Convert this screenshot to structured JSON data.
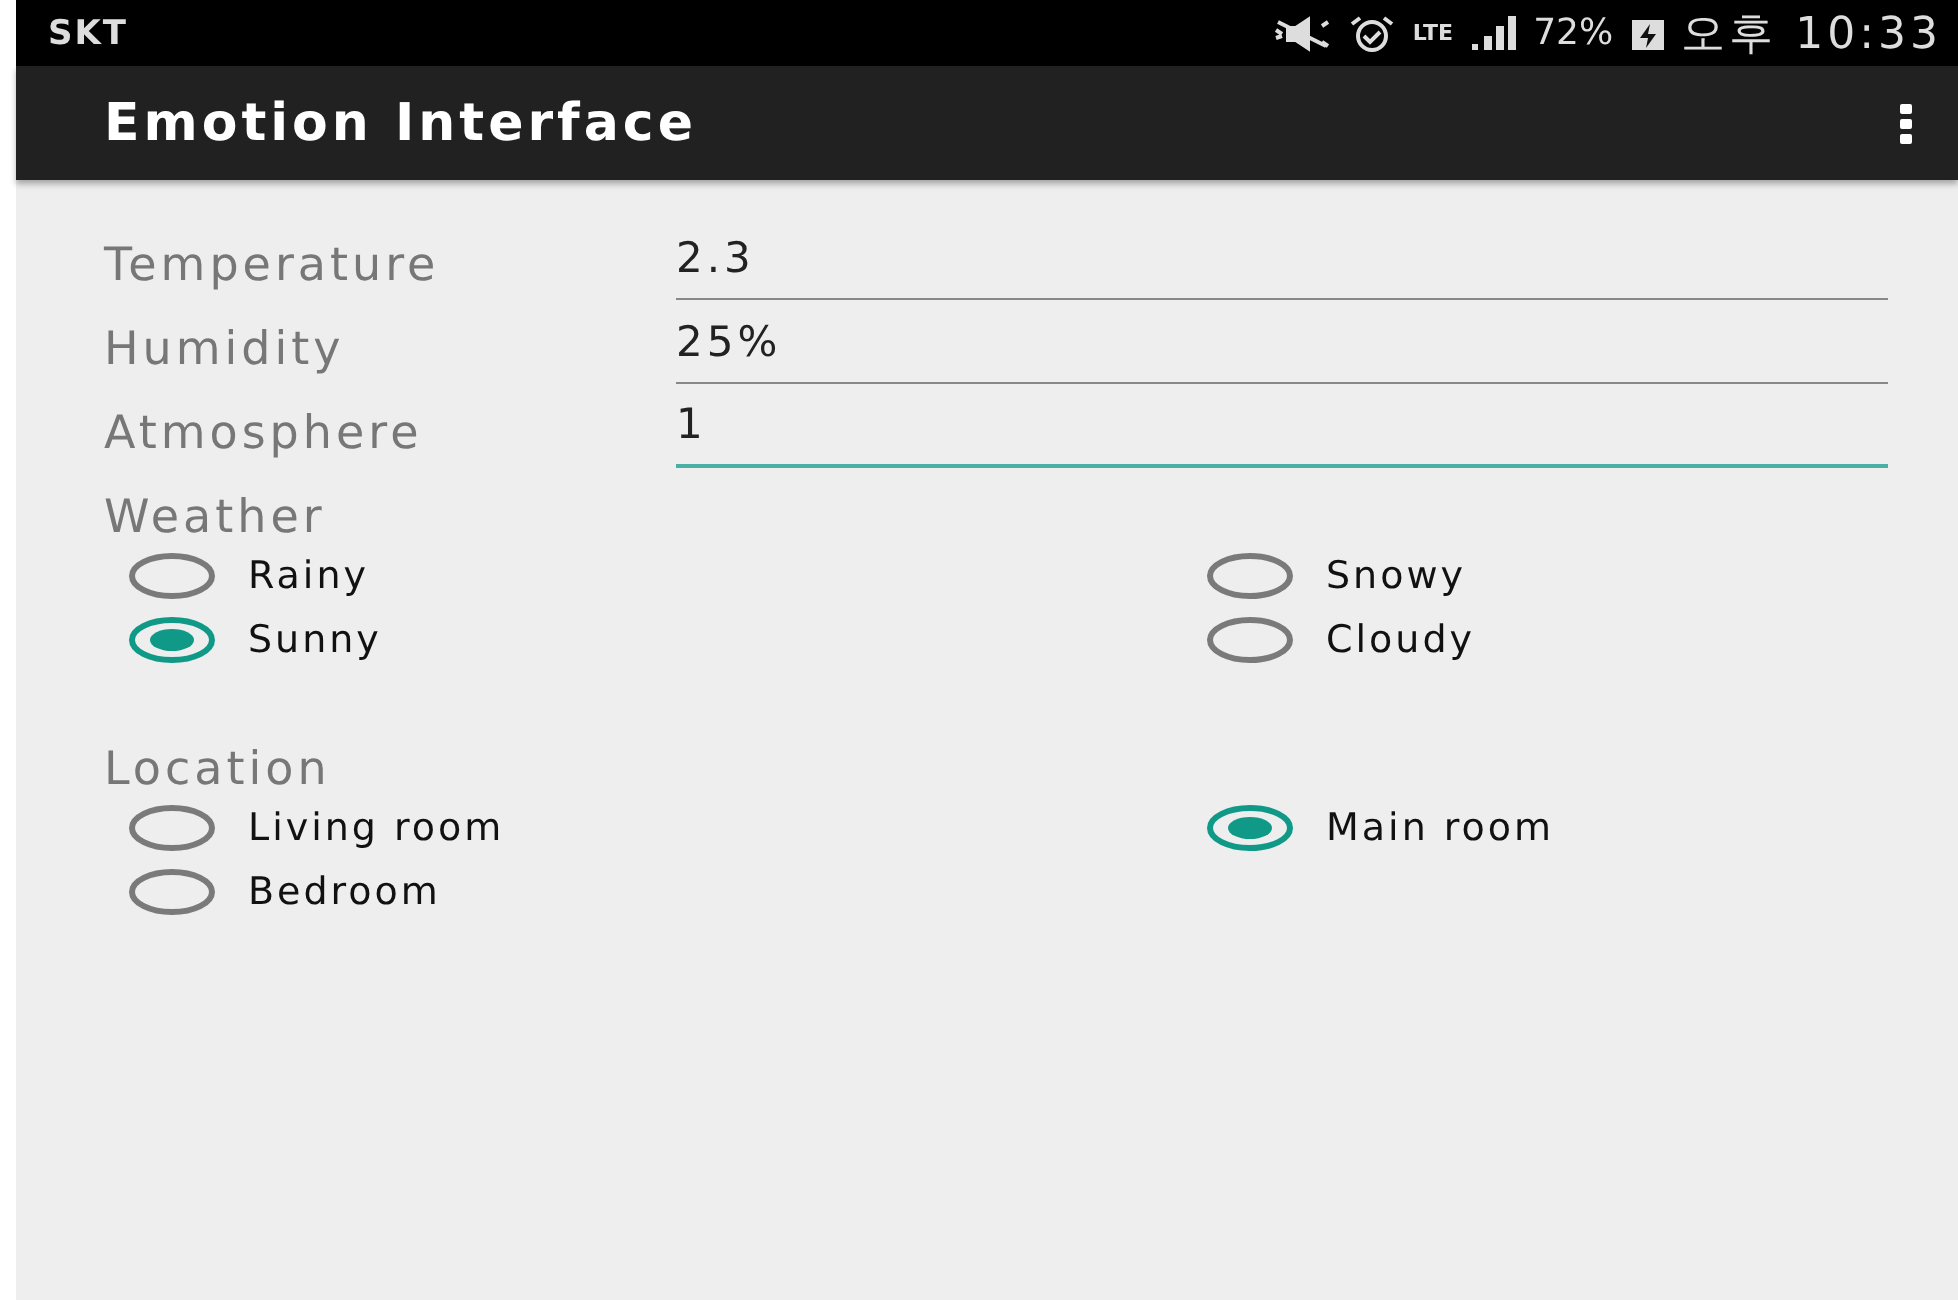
{
  "status_bar": {
    "carrier": "SKT",
    "network": "LTE",
    "battery": "72%",
    "time": "오후 10:33"
  },
  "app_bar": {
    "title": "Emotion Interface"
  },
  "fields": [
    {
      "label": "Temperature",
      "value": "2.3",
      "focused": false
    },
    {
      "label": "Humidity",
      "value": "25%",
      "focused": false
    },
    {
      "label": "Atmosphere",
      "value": "1",
      "focused": true
    }
  ],
  "groups": [
    {
      "title": "Weather",
      "options": [
        {
          "label": "Rainy",
          "selected": false
        },
        {
          "label": "Snowy",
          "selected": false
        },
        {
          "label": "Sunny",
          "selected": true
        },
        {
          "label": "Cloudy",
          "selected": false
        }
      ]
    },
    {
      "title": "Location",
      "options": [
        {
          "label": "Living room",
          "selected": false
        },
        {
          "label": "Main room",
          "selected": true
        },
        {
          "label": "Bedroom",
          "selected": false
        }
      ]
    }
  ]
}
